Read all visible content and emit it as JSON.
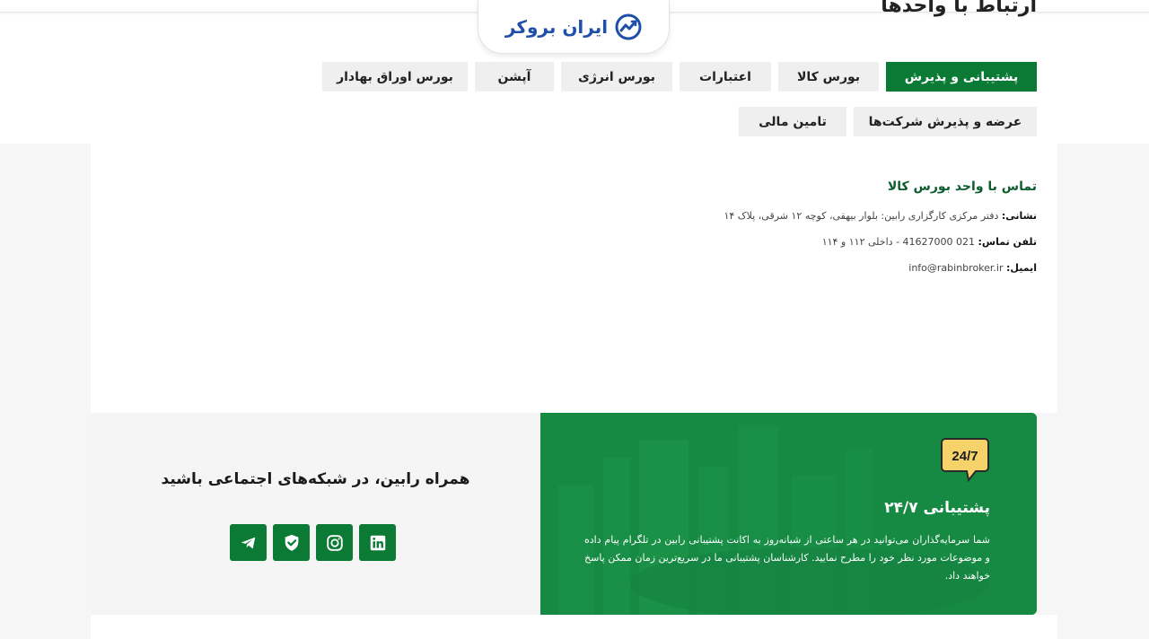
{
  "header": {
    "partial_heading": "ارتباط با واحدها",
    "logo_text": "ایران بروکر"
  },
  "tabs": [
    {
      "label": "پشتیبانی و پذیرش",
      "active": true
    },
    {
      "label": "بورس کالا",
      "active": false
    },
    {
      "label": "اعتبارات",
      "active": false
    },
    {
      "label": "بورس انرژی",
      "active": false
    },
    {
      "label": "آپشن",
      "active": false
    },
    {
      "label": "بورس اوراق بهادار",
      "active": false
    },
    {
      "label": "عرضه و پذیرش شرکت‌ها",
      "active": false
    },
    {
      "label": "تامین مالی",
      "active": false
    }
  ],
  "contact": {
    "title": "تماس با واحد بورس کالا",
    "address_label": "نشانی:",
    "address_value": "دفتر مرکزی کارگزاری رابین: بلوار بیهقی، کوچه ۱۲ شرقی، پلاک ۱۴",
    "phone_label": "تلفن تماس:",
    "phone_value": "021 41627000 - داخلی ۱۱۲ و ۱۱۴",
    "email_label": "ایمیل:",
    "email_value": "info@rabinbroker.ir"
  },
  "social": {
    "title": "همراه رابین، در شبکه‌های اجتماعی باشید",
    "icons": [
      "telegram-icon",
      "shield-check-icon",
      "instagram-icon",
      "linkedin-icon"
    ]
  },
  "support": {
    "badge": "24/7",
    "title": "پشتیبانی ۲۴/۷",
    "description": "شما سرمایه‌گذاران می‌توانید در هر ساعتی از شبانه‌روز به اکانت پشتیبانی رابین در تلگرام پیام داده و موضوعات مورد نظر خود را مطرح نمایید. کارشناسان پشتیبانی ما در سریع‌ترین زمان ممکن پاسخ خواهند داد."
  },
  "colors": {
    "brand_green": "#0a7a35",
    "support_green": "#168a43",
    "badge_yellow": "#f5d36a",
    "logo_blue": "#1f4fa8"
  }
}
